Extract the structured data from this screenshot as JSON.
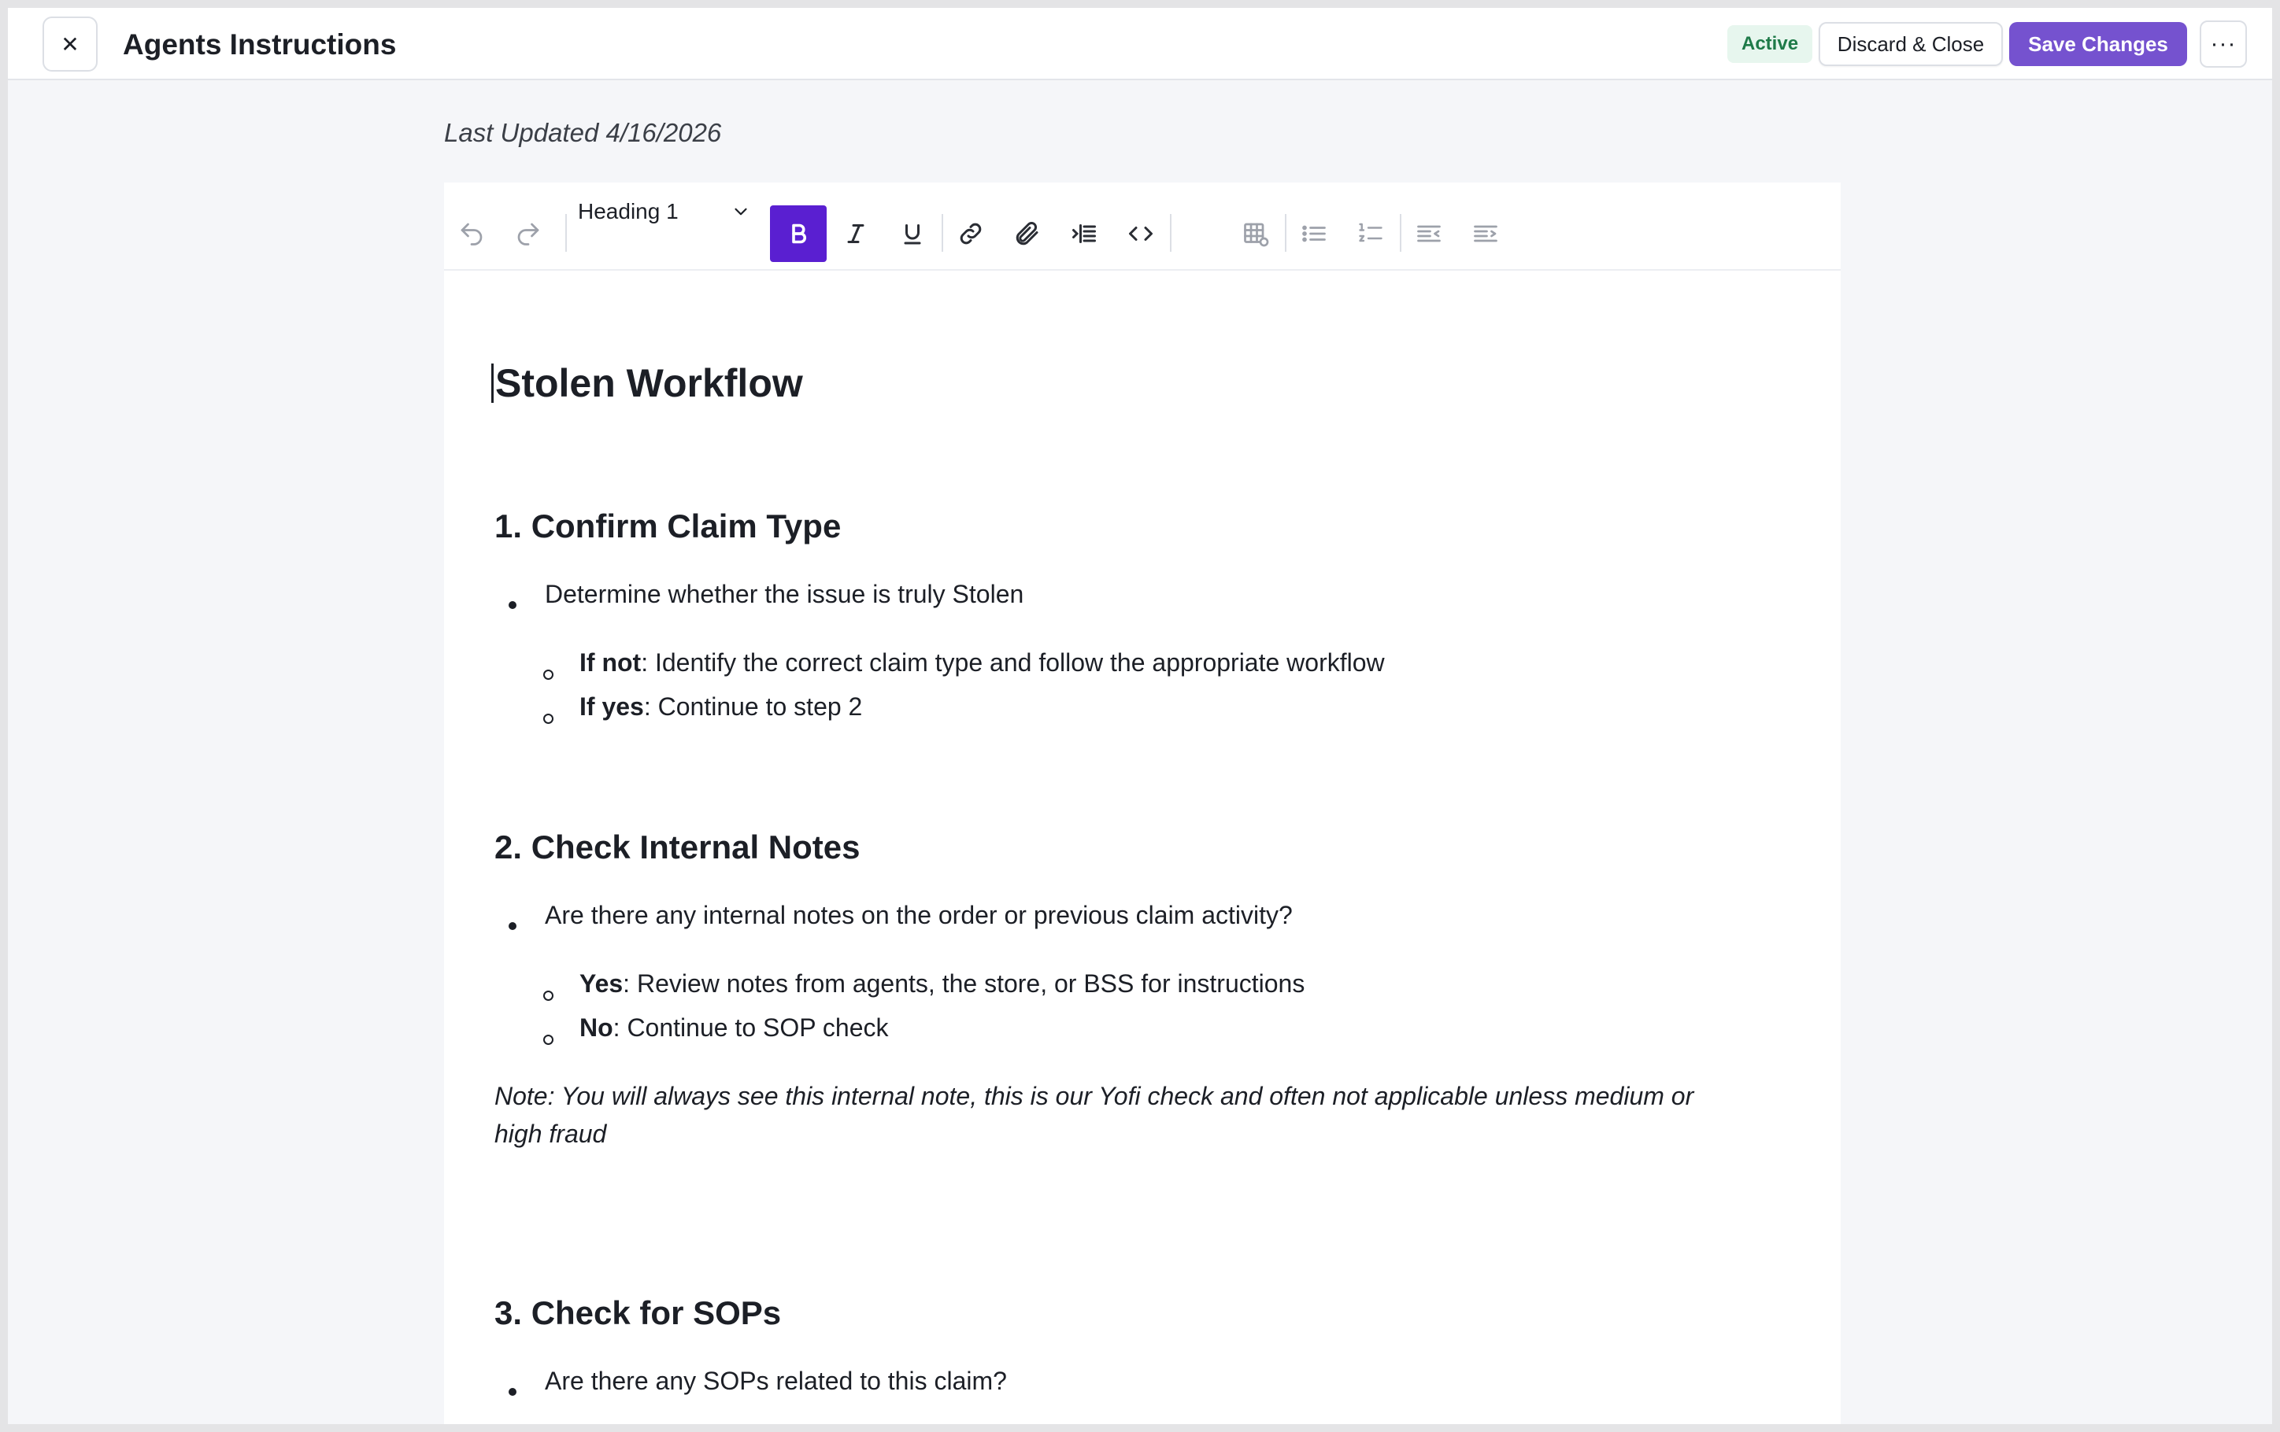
{
  "header": {
    "close_icon": "✕",
    "title": "Agents Instructions",
    "status": "Active",
    "discard_label": "Discard & Close",
    "save_label": "Save Changes",
    "more_icon": "···"
  },
  "last_updated": "Last Updated 4/16/2026",
  "toolbar": {
    "heading_select_value": "Heading 1"
  },
  "doc": {
    "title": "Stolen Workflow",
    "section1": {
      "heading": "1. Confirm Claim Type",
      "bullet": "Determine whether the issue is truly Stolen",
      "sub1_bold": "If not",
      "sub1_text": ": Identify the correct claim type and follow the appropriate workflow",
      "sub2_bold": "If yes",
      "sub2_text": ": Continue to step 2"
    },
    "section2": {
      "heading": "2. Check Internal Notes",
      "bullet": "Are there any internal notes on the order or previous claim activity?",
      "sub1_bold": "Yes",
      "sub1_text": ": Review notes from agents, the store, or BSS for instructions",
      "sub2_bold": "No",
      "sub2_text": ": Continue to SOP check",
      "note_line1": "Note: You will always see this internal note, this is our Yofi check and often not applicable unless medium or",
      "note_line2": "high fraud"
    },
    "section3": {
      "heading": "3. Check for SOPs",
      "bullet": "Are there any SOPs related to this claim?"
    }
  }
}
